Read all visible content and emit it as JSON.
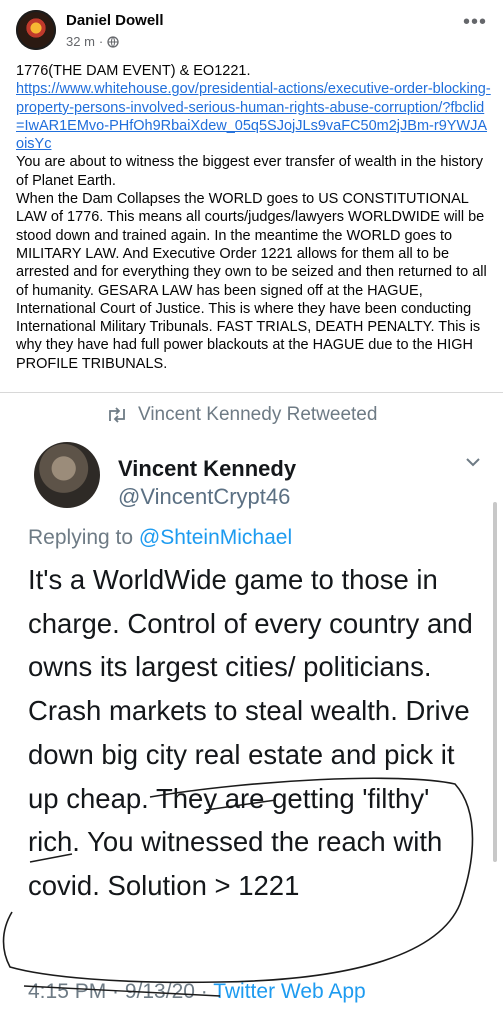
{
  "post": {
    "author": "Daniel Dowell",
    "time": "32 m",
    "separator": "·",
    "more_icon": "more-horizontal-icon",
    "privacy_icon": "globe-icon",
    "line1": "1776(THE DAM EVENT) & EO1221.",
    "link": "https://www.whitehouse.gov/presidential-actions/executive-order-blocking-property-persons-involved-serious-human-rights-abuse-corruption/?fbclid=IwAR1EMvo-PHfOh9RbaiXdew_05q5SJojJLs9vaFC50m2jJBm-r9YWJAoisYc",
    "para1": "You are about to witness the biggest ever transfer of wealth in the history of Planet Earth.",
    "para2": "When the Dam Collapses the WORLD goes to US CONSTITUTIONAL LAW of 1776. This means all courts/judges/lawyers WORLDWIDE will be stood down and trained again. In the meantime the WORLD goes to MILITARY LAW. And Executive Order 1221 allows for them all to be arrested and for everything they own to be seized and then returned to all of humanity. GESARA LAW has been signed off at the HAGUE, International Court of Justice. This is where they have been conducting International Military Tribunals. FAST TRIALS, DEATH PENALTY. This is why they have had full power blackouts at the HAGUE due to the HIGH PROFILE TRIBUNALS."
  },
  "tweet": {
    "retweet_label": "Vincent Kennedy Retweeted",
    "retweet_icon": "retweet-icon",
    "name": "Vincent Kennedy",
    "handle": "@VincentCrypt46",
    "replying_prefix": "Replying to ",
    "replying_to": "@ShteinMichael",
    "body": "It's a WorldWide game to those in charge. Control of every country and owns its largest cities/ politicians. Crash markets to steal wealth. Drive down big city real estate and pick it up cheap. They are getting 'filthy' rich. You witnessed the reach with covid. Solution  > 1221",
    "timestamp": "4:15 PM · 9/13/20 · ",
    "app": "Twitter Web App",
    "chevron_icon": "chevron-down-icon"
  }
}
